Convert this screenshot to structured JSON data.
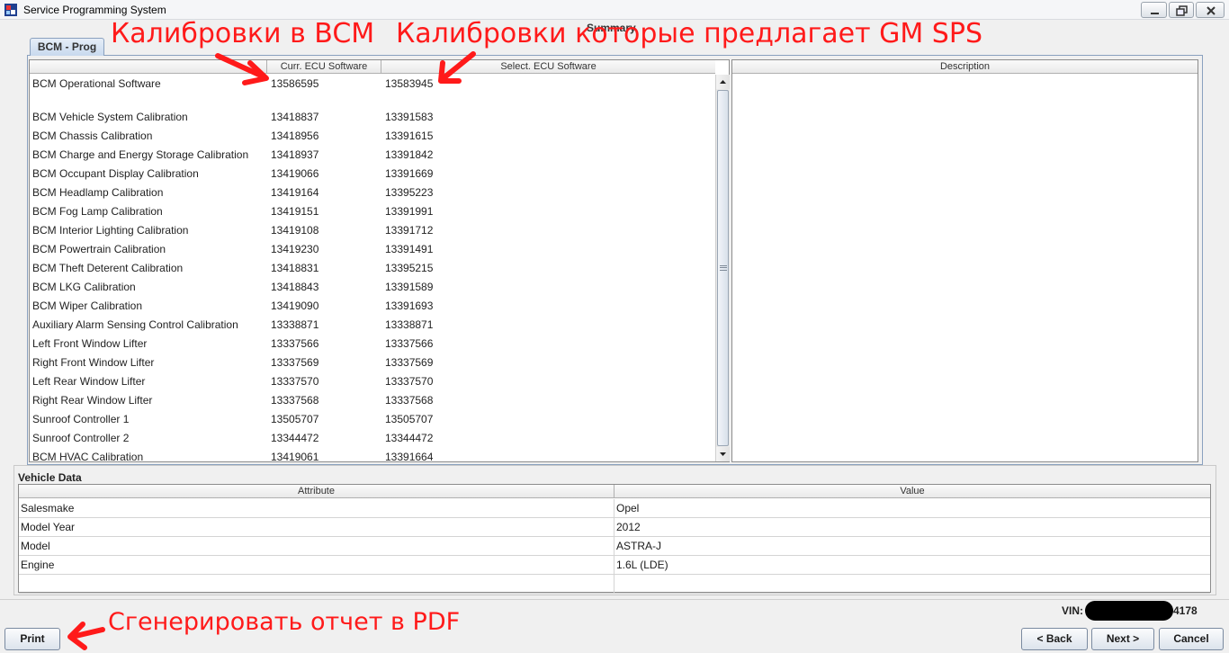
{
  "window": {
    "title": "Service Programming System"
  },
  "summary_title": "Summary",
  "tab": {
    "label": "BCM - Prog"
  },
  "software_table": {
    "headers": {
      "name": "",
      "current": "Curr. ECU Software",
      "selected": "Select. ECU Software"
    },
    "rows": [
      {
        "name": "BCM Operational Software",
        "current": "13586595",
        "selected": "13583945"
      },
      {
        "name": "BCM Vehicle System Calibration",
        "current": "13418837",
        "selected": "13391583"
      },
      {
        "name": "BCM Chassis Calibration",
        "current": "13418956",
        "selected": "13391615"
      },
      {
        "name": "BCM Charge and Energy Storage Calibration",
        "current": "13418937",
        "selected": "13391842"
      },
      {
        "name": "BCM Occupant Display Calibration",
        "current": "13419066",
        "selected": "13391669"
      },
      {
        "name": "BCM Headlamp Calibration",
        "current": "13419164",
        "selected": "13395223"
      },
      {
        "name": "BCM Fog Lamp Calibration",
        "current": "13419151",
        "selected": "13391991"
      },
      {
        "name": "BCM Interior Lighting Calibration",
        "current": "13419108",
        "selected": "13391712"
      },
      {
        "name": "BCM Powertrain Calibration",
        "current": "13419230",
        "selected": "13391491"
      },
      {
        "name": "BCM Theft Deterent Calibration",
        "current": "13418831",
        "selected": "13395215"
      },
      {
        "name": "BCM LKG Calibration",
        "current": "13418843",
        "selected": "13391589"
      },
      {
        "name": "BCM Wiper Calibration",
        "current": "13419090",
        "selected": "13391693"
      },
      {
        "name": "Auxiliary Alarm Sensing Control Calibration",
        "current": "13338871",
        "selected": "13338871"
      },
      {
        "name": "Left Front Window Lifter",
        "current": "13337566",
        "selected": "13337566"
      },
      {
        "name": "Right Front Window Lifter",
        "current": "13337569",
        "selected": "13337569"
      },
      {
        "name": "Left Rear Window Lifter",
        "current": "13337570",
        "selected": "13337570"
      },
      {
        "name": "Right Rear Window Lifter",
        "current": "13337568",
        "selected": "13337568"
      },
      {
        "name": "Sunroof Controller 1",
        "current": "13505707",
        "selected": "13505707"
      },
      {
        "name": "Sunroof Controller 2",
        "current": "13344472",
        "selected": "13344472"
      },
      {
        "name": "BCM HVAC Calibration",
        "current": "13419061",
        "selected": "13391664"
      }
    ]
  },
  "description_table": {
    "header": "Description"
  },
  "vehicle_data": {
    "title": "Vehicle Data",
    "headers": {
      "attribute": "Attribute",
      "value": "Value"
    },
    "rows": [
      {
        "attribute": "Salesmake",
        "value": "Opel"
      },
      {
        "attribute": "Model Year",
        "value": "2012"
      },
      {
        "attribute": "Model",
        "value": "ASTRA-J"
      },
      {
        "attribute": "Engine",
        "value": "1.6L (LDE)"
      }
    ]
  },
  "vin": {
    "label": "VIN:",
    "visible_suffix": "4178"
  },
  "buttons": {
    "print": "Print",
    "back": "< Back",
    "next": "Next >",
    "cancel": "Cancel"
  },
  "annotations": {
    "current_calibrations": "Калибровки в BCM",
    "offered_calibrations": "Калибровки которые предлагает GM SPS",
    "print_pdf": "Сгенерировать отчет в PDF",
    "color": "#ff1a1a"
  }
}
